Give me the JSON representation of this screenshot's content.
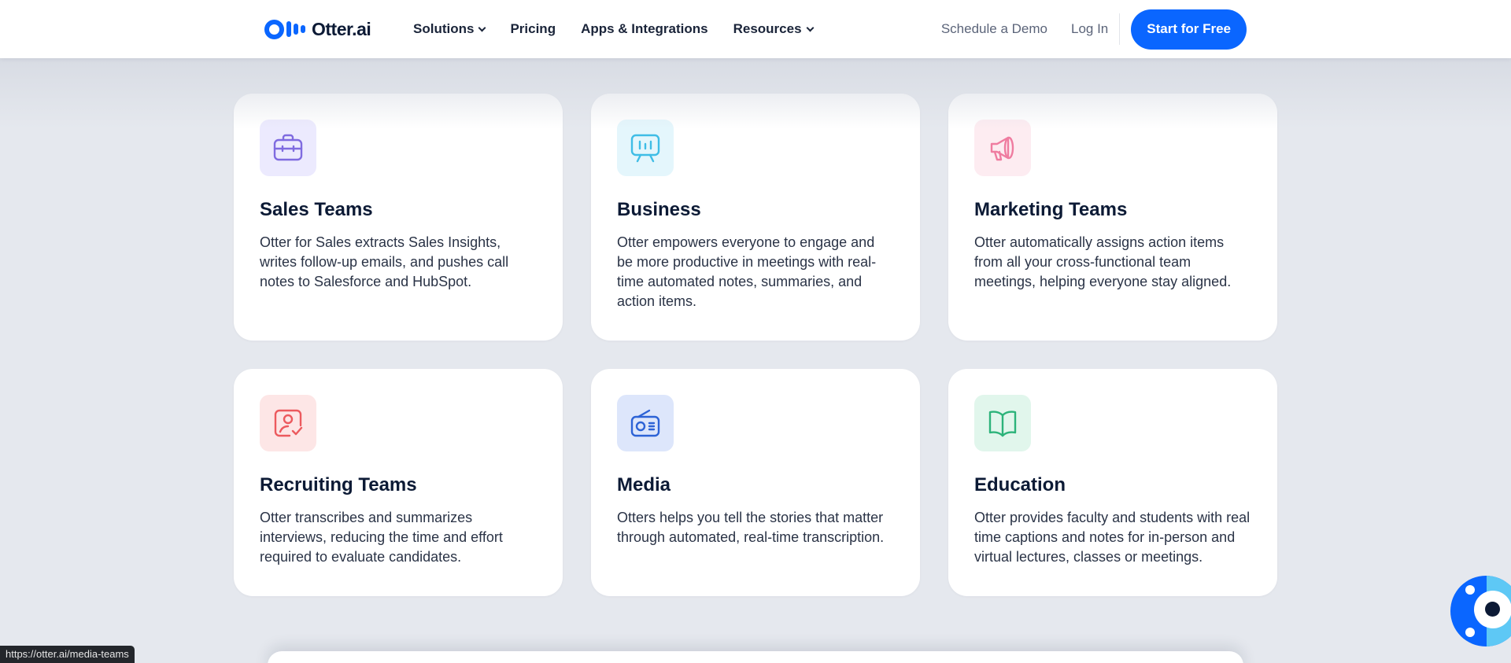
{
  "header": {
    "logo_text": "Otter.ai",
    "nav": [
      {
        "label": "Solutions",
        "has_dropdown": true
      },
      {
        "label": "Pricing",
        "has_dropdown": false
      },
      {
        "label": "Apps & Integrations",
        "has_dropdown": false
      },
      {
        "label": "Resources",
        "has_dropdown": true
      }
    ],
    "schedule_demo": "Schedule a Demo",
    "log_in": "Log In",
    "cta": "Start for Free"
  },
  "cards": [
    {
      "title": "Sales Teams",
      "body": "Otter for Sales extracts Sales Insights, writes follow-up emails, and pushes call notes to Salesforce and HubSpot.",
      "icon": "briefcase-icon",
      "tile_color": "#eceafe",
      "icon_color": "#7f6be0"
    },
    {
      "title": "Business",
      "body": "Otter empowers everyone to engage and be more productive in meetings with real-time automated notes, summaries, and action items.",
      "icon": "presentation-board-icon",
      "tile_color": "#e4f6fc",
      "icon_color": "#3fbde6"
    },
    {
      "title": "Marketing Teams",
      "body": "Otter automatically assigns action items from all your cross-functional team meetings, helping everyone stay aligned.",
      "icon": "megaphone-icon",
      "tile_color": "#fdecf1",
      "icon_color": "#ef7ca0"
    },
    {
      "title": "Recruiting Teams",
      "body": "Otter transcribes and summarizes interviews, reducing the time and effort required to evaluate candidates.",
      "icon": "candidate-check-icon",
      "tile_color": "#fde6e6",
      "icon_color": "#ec5a5e"
    },
    {
      "title": "Media",
      "body": "Otters helps you tell the stories that matter through automated, real-time transcription.",
      "icon": "radio-icon",
      "tile_color": "#dde6fb",
      "icon_color": "#2d63d6"
    },
    {
      "title": "Education",
      "body": "Otter provides faculty and students with real time captions and notes for in-person and virtual lectures, classes or meetings.",
      "icon": "book-icon",
      "tile_color": "#e1f6ec",
      "icon_color": "#2cb37a"
    }
  ],
  "status_url": "https://otter.ai/media-teams",
  "colors": {
    "brand": "#0a66ff",
    "page_bg": "#e5e8ee",
    "text": "#0c1a35"
  }
}
